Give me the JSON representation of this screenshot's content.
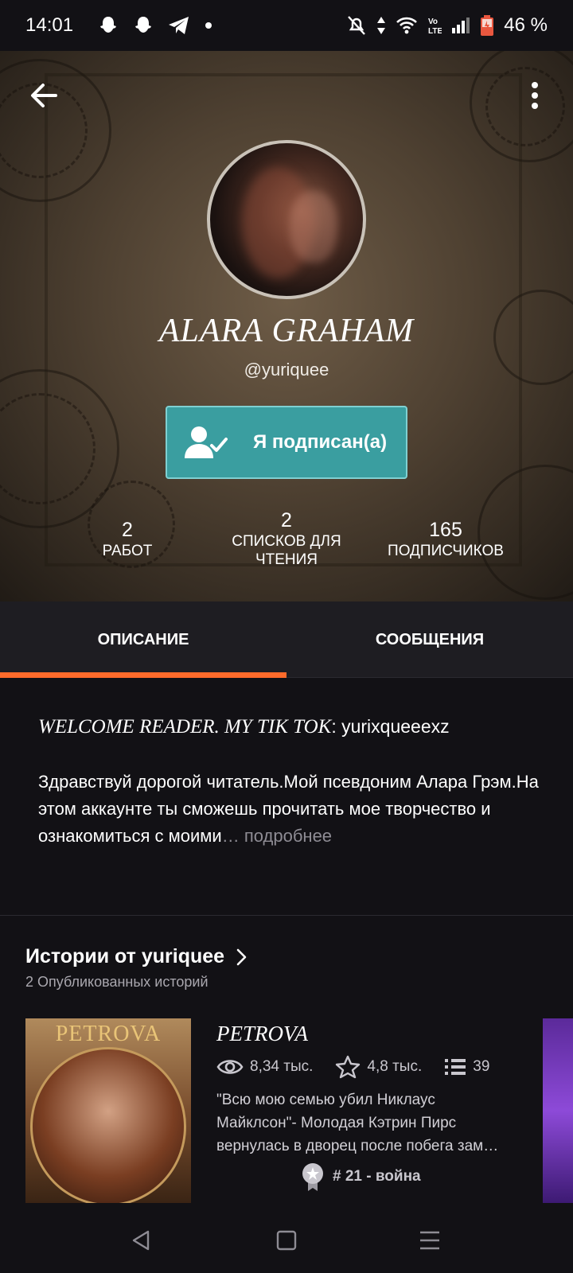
{
  "status_bar": {
    "time": "14:01",
    "battery": "46 %",
    "icons": [
      "snapchat-icon",
      "snapchat-icon",
      "telegram-icon",
      "dot-icon",
      "mute-icon",
      "data-arrows-icon",
      "wifi-icon",
      "volte-icon",
      "signal-icon",
      "battery-icon"
    ]
  },
  "profile": {
    "display_name": "ALARA GRAHAM",
    "username": "@yuriquee",
    "follow_button": "Я подписан(а)",
    "stats": [
      {
        "value": "2",
        "label": "РАБОТ"
      },
      {
        "value": "2",
        "label": "СПИСКОВ ДЛЯ ЧТЕНИЯ"
      },
      {
        "value": "165",
        "label": "ПОДПИСЧИКОВ"
      }
    ]
  },
  "tabs": [
    {
      "label": "ОПИСАНИЕ",
      "active": true
    },
    {
      "label": "СООБЩЕНИЯ",
      "active": false
    }
  ],
  "about": {
    "welcome_styled": "WELCOME READER. MY TIK TOK",
    "welcome_plain": ": yurixqueeexz",
    "bio": "Здравствуй дорогой читатель.Мой псевдоним Алара Грэм.На этом аккаунте ты сможешь прочитать мое творчество и ознакомиться с моими",
    "ellipsis": "…",
    "more": " подробнее"
  },
  "stories": {
    "title": "Истории от yuriquee",
    "subtitle": "2 Опубликованных историй",
    "items": [
      {
        "cover_text": "PETROVA",
        "title": "PETROVA",
        "reads": "8,34 тыс.",
        "votes": "4,8 тыс.",
        "parts": "39",
        "description": "\"Всю мою семью убил Никлаус Майклсон\"- Молодая Кэтрин Пирс вернулась в дворец после побега зам…",
        "rank": "# 21 - война"
      }
    ]
  },
  "colors": {
    "accent": "#ff6b2b",
    "follow_button": "#3a9ea0",
    "background": "#121115"
  }
}
